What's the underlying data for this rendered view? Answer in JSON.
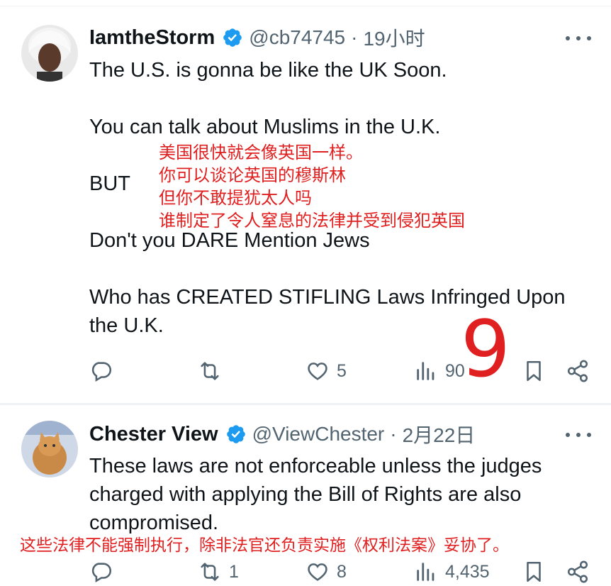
{
  "tweets": [
    {
      "display_name": "IamtheStorm",
      "handle": "@cb74745",
      "separator": "·",
      "time": "19小时",
      "lines": [
        "The U.S. is gonna be like the UK Soon.",
        "",
        "You can talk about Muslims in the U.K.",
        "",
        "BUT",
        "",
        "Don't you DARE Mention Jews",
        "",
        "Who has CREATED STIFLING Laws Infringed Upon",
        "the U.K."
      ],
      "reply_count": "",
      "retweet_count": "",
      "like_count": "5",
      "view_count": "90"
    },
    {
      "display_name": "Chester View",
      "handle": "@ViewChester",
      "separator": "·",
      "time": "2月22日",
      "lines": [
        "These laws are not enforceable unless the judges",
        "charged with applying the Bill of Rights are also",
        "compromised."
      ],
      "reply_count": "",
      "retweet_count": "1",
      "like_count": "8",
      "view_count": "4,435"
    }
  ],
  "annotations": {
    "translation_1": [
      "美国很快就会像英国一样。",
      "你可以谈论英国的穆斯林",
      "但你不敢提犹太人吗",
      "谁制定了令人窒息的法律并受到侵犯英国"
    ],
    "big_number": "9",
    "translation_2": "这些法律不能强制执行，除非法官还负责实施《权利法案》妥协了。"
  },
  "colors": {
    "text": "#0f1419",
    "secondary": "#536471",
    "verified": "#1d9bf0",
    "annotation": "#e02020"
  },
  "icons": [
    "reply-icon",
    "retweet-icon",
    "like-icon",
    "views-icon",
    "bookmark-icon",
    "share-icon",
    "more-icon",
    "verified-icon"
  ]
}
